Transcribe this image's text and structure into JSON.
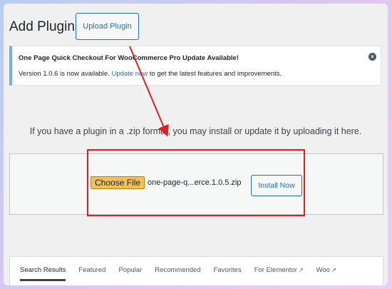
{
  "header": {
    "title": "Add Plugins",
    "upload_button": "Upload Plugin"
  },
  "notice": {
    "title": "One Page Quick Checkout For WooCommerce Pro Update Available!",
    "body_prefix": "Version 1.0.6 is now available.",
    "link_text": "Update now",
    "body_suffix": "to get the latest features and improvements.",
    "dismiss_icon": "dismiss-icon"
  },
  "upload": {
    "help_text": "If you have a plugin in a .zip format, you may install or update it by uploading it here.",
    "choose_file_label": "Choose File",
    "file_name": "one-page-q...erce.1.0.5.zip",
    "install_button": "Install Now"
  },
  "tabs": [
    {
      "label": "Search Results",
      "active": true
    },
    {
      "label": "Featured"
    },
    {
      "label": "Popular"
    },
    {
      "label": "Recommended"
    },
    {
      "label": "Favorites"
    },
    {
      "label": "For Elementor",
      "external": true
    },
    {
      "label": "Woo",
      "external": true
    }
  ],
  "colors": {
    "accent": "#2271b1",
    "annotation": "#e02020"
  }
}
